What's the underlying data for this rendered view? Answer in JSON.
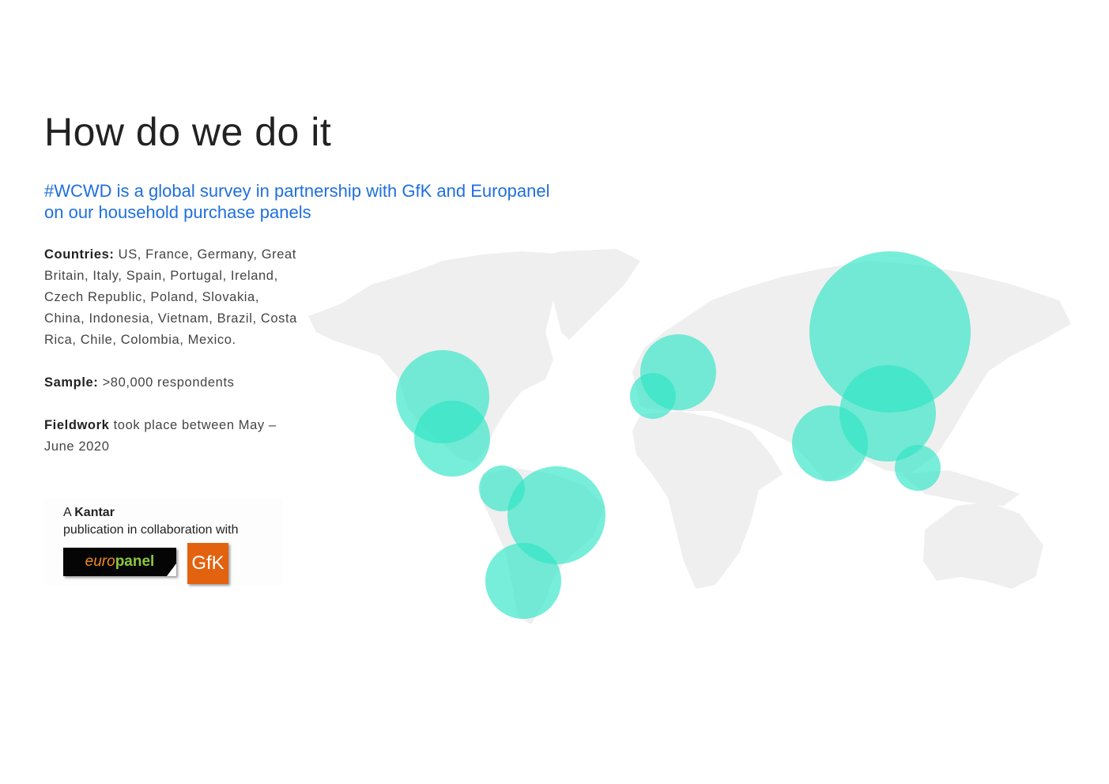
{
  "title": "How do we do it",
  "subtitle": "#WCWD is a global survey in partnership with GfK and Europanel on our household purchase panels",
  "details": {
    "countries_label": "Countries:",
    "countries_value": " US, France, Germany, Great Britain, Italy, Spain, Portugal, Ireland, Czech Republic, Poland, Slovakia, China, Indonesia, Vietnam,  Brazil, Costa Rica, Chile, Colombia, Mexico.",
    "sample_label": "Sample:",
    "sample_value": " >80,000 respondents",
    "fieldwork_label": "Fieldwork",
    "fieldwork_value": " took place between May – June 2020"
  },
  "credit": {
    "prefix": "A ",
    "brand": "Kantar",
    "suffix": " publication in collaboration with",
    "logo_europanel": "europanel",
    "logo_gfk": "GfK"
  },
  "colors": {
    "bubble": "#2ee5c5",
    "land": "#efefef",
    "accent": "#1f6fdc"
  }
}
